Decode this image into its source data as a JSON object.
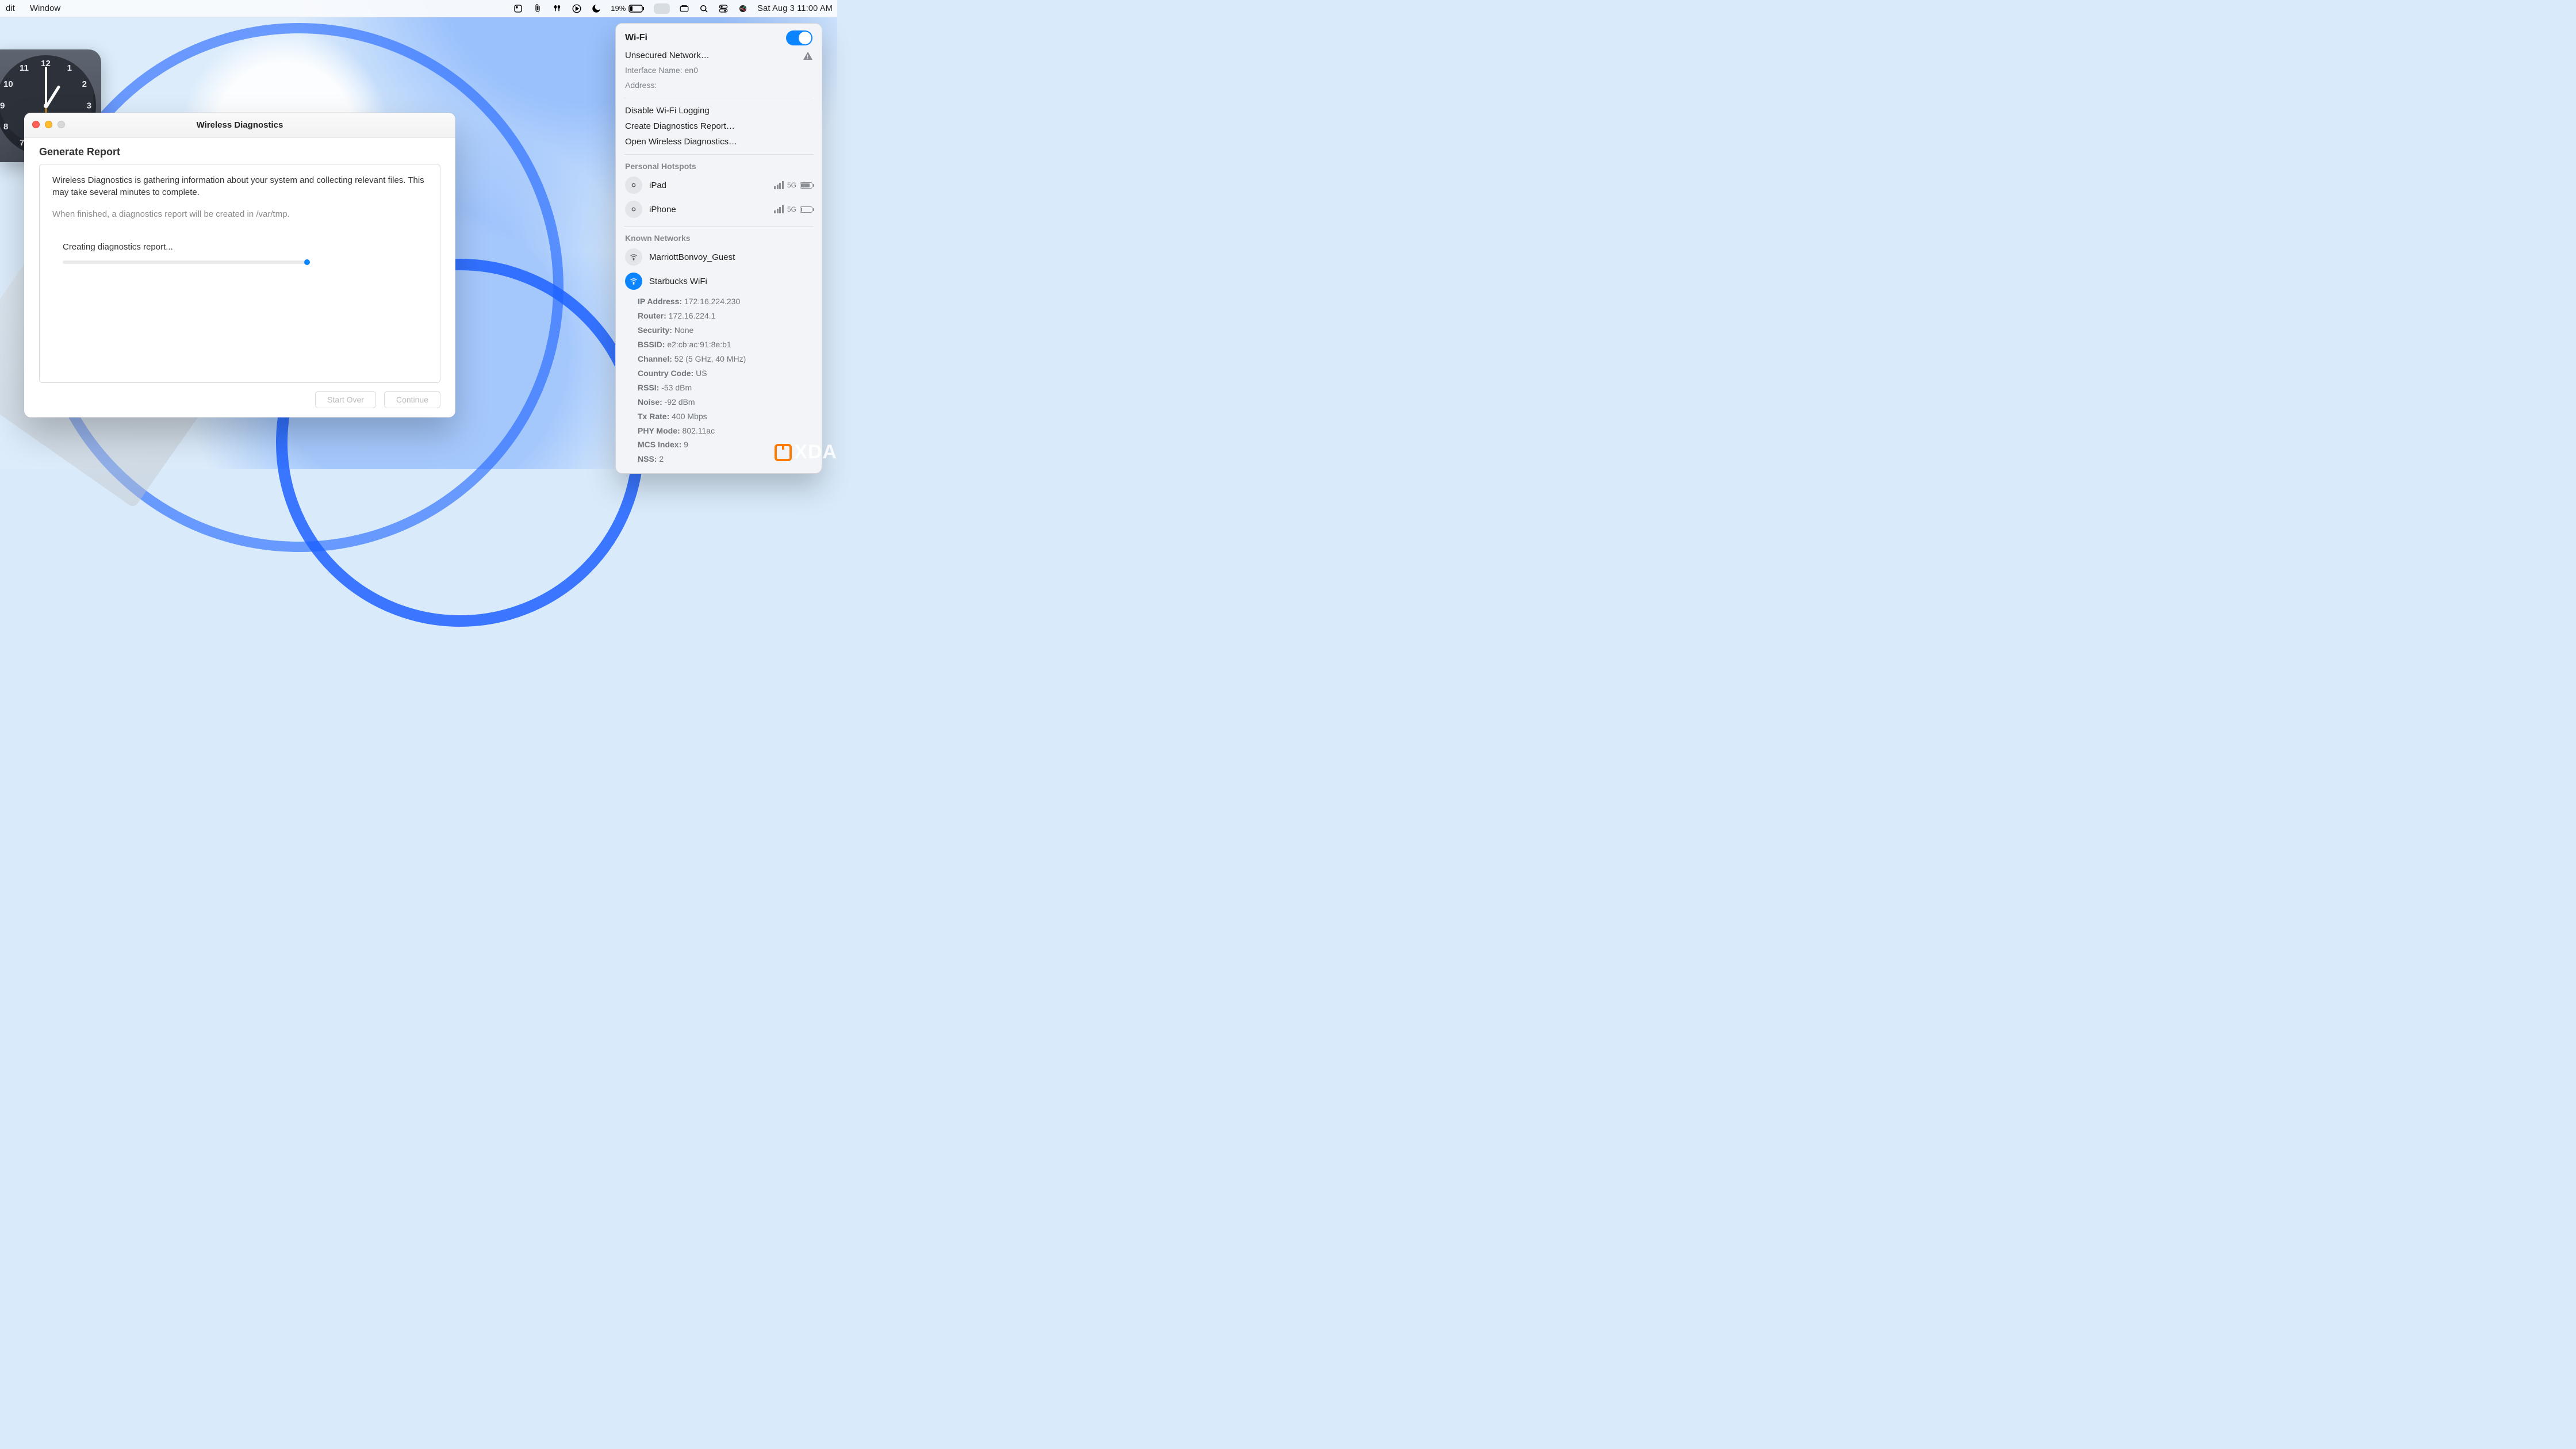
{
  "menubar": {
    "left": [
      "dit",
      "Window"
    ],
    "battery_pct": "19%",
    "clock_text": "Sat Aug 3  11:00 AM"
  },
  "window": {
    "title": "Wireless Diagnostics",
    "heading": "Generate Report",
    "p1": "Wireless Diagnostics is gathering information about your system and collecting relevant files. This may take several minutes to complete.",
    "p2": "When finished, a diagnostics report will be created in /var/tmp.",
    "p3": "Creating diagnostics report...",
    "btn_start_over": "Start Over",
    "btn_continue": "Continue"
  },
  "wifi": {
    "title": "Wi-Fi",
    "unsecured": "Unsecured Network…",
    "iface_label": "Interface Name:",
    "iface_value": "en0",
    "addr_label": "Address:",
    "addr_value": "",
    "disable_logging": "Disable Wi-Fi Logging",
    "create_report": "Create Diagnostics Report…",
    "open_diag": "Open Wireless Diagnostics…",
    "hotspots_label": "Personal Hotspots",
    "hotspots": [
      {
        "name": "iPad",
        "band": "5G",
        "batt": 0.85
      },
      {
        "name": "iPhone",
        "band": "5G",
        "batt": 0.1
      }
    ],
    "known_label": "Known Networks",
    "known": [
      {
        "name": "MarriottBonvoy_Guest",
        "active": false
      },
      {
        "name": "Starbucks WiFi",
        "active": true
      }
    ],
    "details": {
      "IP Address": "172.16.224.230",
      "Router": "172.16.224.1",
      "Security": "None",
      "BSSID": "e2:cb:ac:91:8e:b1",
      "Channel": "52 (5 GHz, 40 MHz)",
      "Country Code": "US",
      "RSSI": "-53 dBm",
      "Noise": "-92 dBm",
      "Tx Rate": "400 Mbps",
      "PHY Mode": "802.11ac",
      "MCS Index": "9",
      "NSS": "2"
    }
  },
  "watermark": "XDA"
}
